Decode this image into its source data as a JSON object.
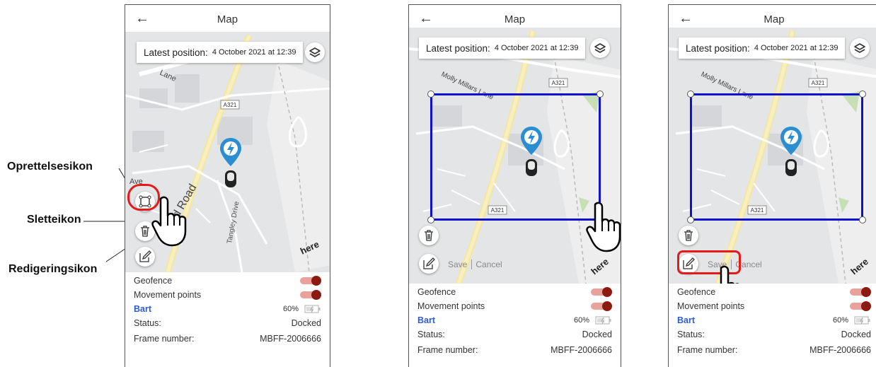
{
  "callouts": {
    "create": "Oprettelsesikon",
    "delete": "Sletteikon",
    "edit": "Redigeringsikon"
  },
  "screen": {
    "title": "Map",
    "back_icon": "back-arrow-icon",
    "latest_label": "Latest position:",
    "latest_value": "4 October 2021 at 12:39",
    "save_label": "Save",
    "cancel_label": "Cancel",
    "road_labels": {
      "stead": "stead Road",
      "tangley": "Tangley Drive",
      "molly": "Molly Millars Lane",
      "a321": "A321",
      "here": "here",
      "lane": "Lane",
      "ave": "Ave"
    },
    "details": {
      "geofence": "Geofence",
      "movement": "Movement points",
      "bike_name": "Bart",
      "battery": "60%",
      "status_label": "Status:",
      "status_value": "Docked",
      "frame_label": "Frame number:",
      "frame_value": "MBFF-2006666"
    }
  },
  "colors": {
    "accent_blue": "#2f5bd1",
    "geofence_outline": "#1010d0",
    "highlight_red": "#e51b1b",
    "toggle_on": "#8b1a10"
  }
}
